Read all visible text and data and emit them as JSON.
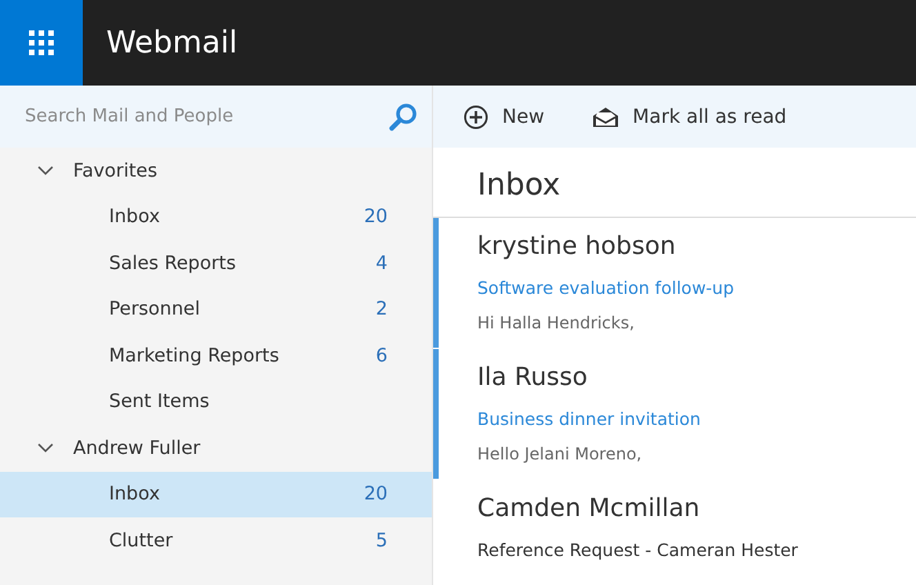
{
  "header": {
    "title": "Webmail"
  },
  "search": {
    "placeholder": "Search Mail and People"
  },
  "toolbar": [
    {
      "kind": "new",
      "label": "New"
    },
    {
      "kind": "mark-read",
      "label": "Mark all as read"
    }
  ],
  "folders": [
    {
      "label": "Favorites",
      "expanded": true,
      "children": [
        {
          "label": "Inbox",
          "count": "20",
          "selected": false
        },
        {
          "label": "Sales Reports",
          "count": "4",
          "selected": false
        },
        {
          "label": "Personnel",
          "count": "2",
          "selected": false
        },
        {
          "label": "Marketing Reports",
          "count": "6",
          "selected": false
        },
        {
          "label": "Sent Items",
          "selected": false
        }
      ]
    },
    {
      "label": "Andrew Fuller",
      "expanded": true,
      "children": [
        {
          "label": "Inbox",
          "count": "20",
          "selected": true
        },
        {
          "label": "Clutter",
          "count": "5",
          "selected": false
        }
      ]
    }
  ],
  "mail_list": {
    "title": "Inbox",
    "messages": [
      {
        "sender": "krystine hobson",
        "subject": "Software evaluation follow-up",
        "preview": "Hi Halla Hendricks,",
        "unread": true
      },
      {
        "sender": "Ila Russo",
        "subject": "Business dinner invitation",
        "preview": "Hello Jelani Moreno,",
        "unread": true
      },
      {
        "sender": "Camden Mcmillan",
        "subject": "Reference Request - Cameran Hester",
        "unread": false
      }
    ]
  }
}
